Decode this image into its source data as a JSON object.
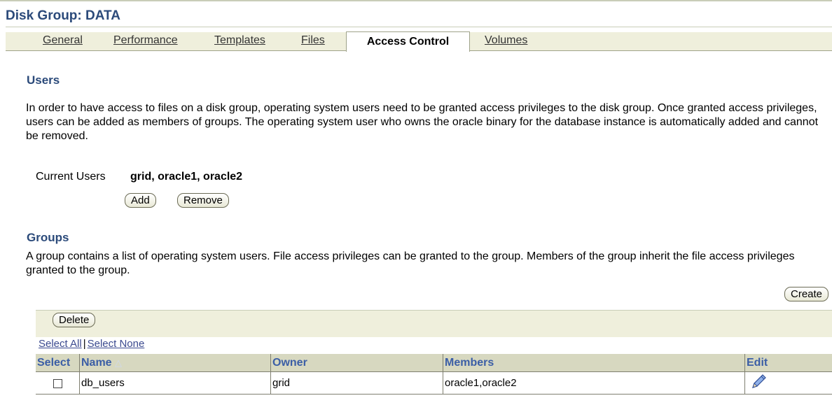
{
  "page": {
    "title": "Disk Group: DATA"
  },
  "tabs": [
    {
      "label": "General"
    },
    {
      "label": "Performance"
    },
    {
      "label": "Templates"
    },
    {
      "label": "Files"
    },
    {
      "label": "Access Control",
      "active": true
    },
    {
      "label": "Volumes"
    }
  ],
  "users": {
    "heading": "Users",
    "description": "In order to have access to files on a disk group, operating system users need to be granted access privileges to the disk group. Once granted access privileges, users can be added as members of groups. The operating system user who owns the oracle binary for the database instance is automatically added and cannot be removed.",
    "current_label": "Current Users",
    "current_value": "grid, oracle1, oracle2",
    "add_label": "Add",
    "remove_label": "Remove"
  },
  "groups": {
    "heading": "Groups",
    "description": "A group contains a list of operating system users. File access privileges can be granted to the group. Members of the group inherit the file access privileges granted to the group.",
    "create_label": "Create",
    "delete_label": "Delete",
    "select_all": "Select All",
    "select_none": "Select None",
    "separator": "|",
    "columns": {
      "select": "Select",
      "name": "Name",
      "owner": "Owner",
      "members": "Members",
      "edit": "Edit"
    },
    "sort_indicator": "△",
    "rows": [
      {
        "name": "db_users",
        "owner": "grid",
        "members": "oracle1,oracle2"
      }
    ]
  },
  "icons": {
    "edit": "pencil-icon",
    "sort": "sort-ascending-icon",
    "checkbox": "checkbox-unchecked"
  },
  "colors": {
    "heading": "#2b4a7a",
    "column_header": "#3b5ea6",
    "panel_bg": "#efefdc",
    "link": "#3b4a8f"
  }
}
